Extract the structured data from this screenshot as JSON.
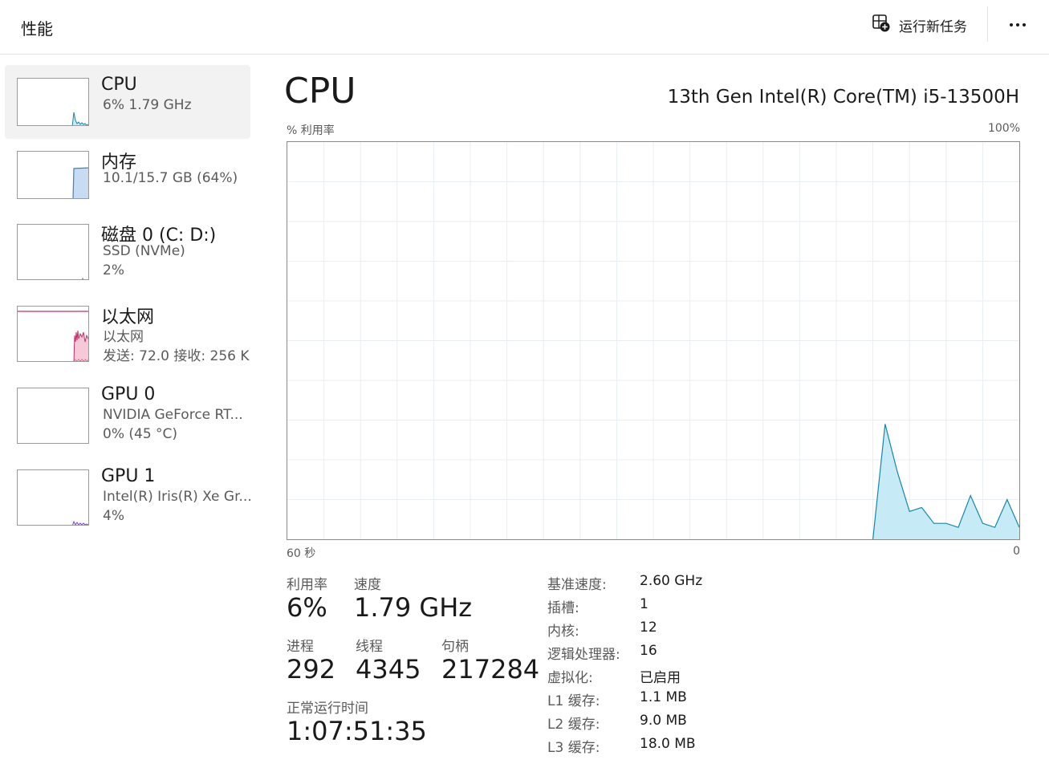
{
  "header": {
    "title": "性能",
    "run_new_task": "运行新任务"
  },
  "sidebar": {
    "items": [
      {
        "name": "CPU",
        "sub1": "6%  1.79 GHz",
        "sub2": ""
      },
      {
        "name": "内存",
        "sub1": "10.1/15.7 GB (64%)",
        "sub2": ""
      },
      {
        "name": "磁盘 0 (C: D:)",
        "sub1": "SSD (NVMe)",
        "sub2": "2%"
      },
      {
        "name": "以太网",
        "sub1": "以太网",
        "sub2": "发送: 72.0  接收: 256 K"
      },
      {
        "name": "GPU 0",
        "sub1": "NVIDIA GeForce RT...",
        "sub2": "0%  (45 °C)"
      },
      {
        "name": "GPU 1",
        "sub1": "Intel(R) Iris(R) Xe Gr...",
        "sub2": "4%"
      }
    ]
  },
  "main": {
    "title": "CPU",
    "model": "13th Gen Intel(R) Core(TM) i5-13500H",
    "graph": {
      "y_label": "% 利用率",
      "y_max_label": "100%",
      "x_left_label": "60 秒",
      "x_right_label": "0"
    },
    "stats": {
      "utilization_label": "利用率",
      "utilization_value": "6%",
      "speed_label": "速度",
      "speed_value": "1.79 GHz",
      "processes_label": "进程",
      "processes_value": "292",
      "threads_label": "线程",
      "threads_value": "4345",
      "handles_label": "句柄",
      "handles_value": "217284",
      "uptime_label": "正常运行时间",
      "uptime_value": "1:07:51:35"
    },
    "specs": [
      {
        "key": "基准速度:",
        "value": "2.60 GHz"
      },
      {
        "key": "插槽:",
        "value": "1"
      },
      {
        "key": "内核:",
        "value": "12"
      },
      {
        "key": "逻辑处理器:",
        "value": "16"
      },
      {
        "key": "虚拟化:",
        "value": "已启用"
      },
      {
        "key": "L1 缓存:",
        "value": "1.1 MB"
      },
      {
        "key": "L2 缓存:",
        "value": "9.0 MB"
      },
      {
        "key": "L3 缓存:",
        "value": "18.0 MB"
      }
    ]
  },
  "colors": {
    "cpu_line": "#1787a8",
    "cpu_fill": "#c6ebf7",
    "memory_line": "#3b82c4",
    "memory_fill": "#c7dcf2",
    "ethernet_line": "#c0306a",
    "ethernet_fill": "#f6c9d8",
    "gpu_line": "#8a3ccf",
    "grid": "#e8eef2"
  },
  "chart_data": {
    "type": "area",
    "ylabel": "% 利用率",
    "ylim": [
      0,
      100
    ],
    "x": [
      60,
      59,
      58,
      57,
      56,
      55,
      54,
      53,
      52,
      51,
      50,
      49,
      48,
      47,
      46,
      45,
      44,
      43,
      42,
      41,
      40,
      39,
      38,
      37,
      36,
      35,
      34,
      33,
      32,
      31,
      30,
      29,
      28,
      27,
      26,
      25,
      24,
      23,
      22,
      21,
      20,
      19,
      18,
      17,
      16,
      15,
      14,
      13,
      12,
      11,
      10,
      9,
      8,
      7,
      6,
      5,
      4,
      3,
      2,
      1,
      0
    ],
    "series": [
      {
        "values": [
          null,
          null,
          null,
          null,
          null,
          null,
          null,
          null,
          null,
          null,
          null,
          null,
          null,
          null,
          null,
          null,
          null,
          null,
          null,
          null,
          null,
          null,
          null,
          null,
          null,
          null,
          null,
          null,
          null,
          null,
          null,
          null,
          null,
          null,
          null,
          null,
          null,
          null,
          null,
          null,
          null,
          null,
          null,
          null,
          null,
          null,
          null,
          null,
          0,
          29,
          17,
          7,
          8,
          4,
          4,
          3,
          11,
          4,
          3,
          10,
          3,
          6
        ]
      }
    ]
  }
}
